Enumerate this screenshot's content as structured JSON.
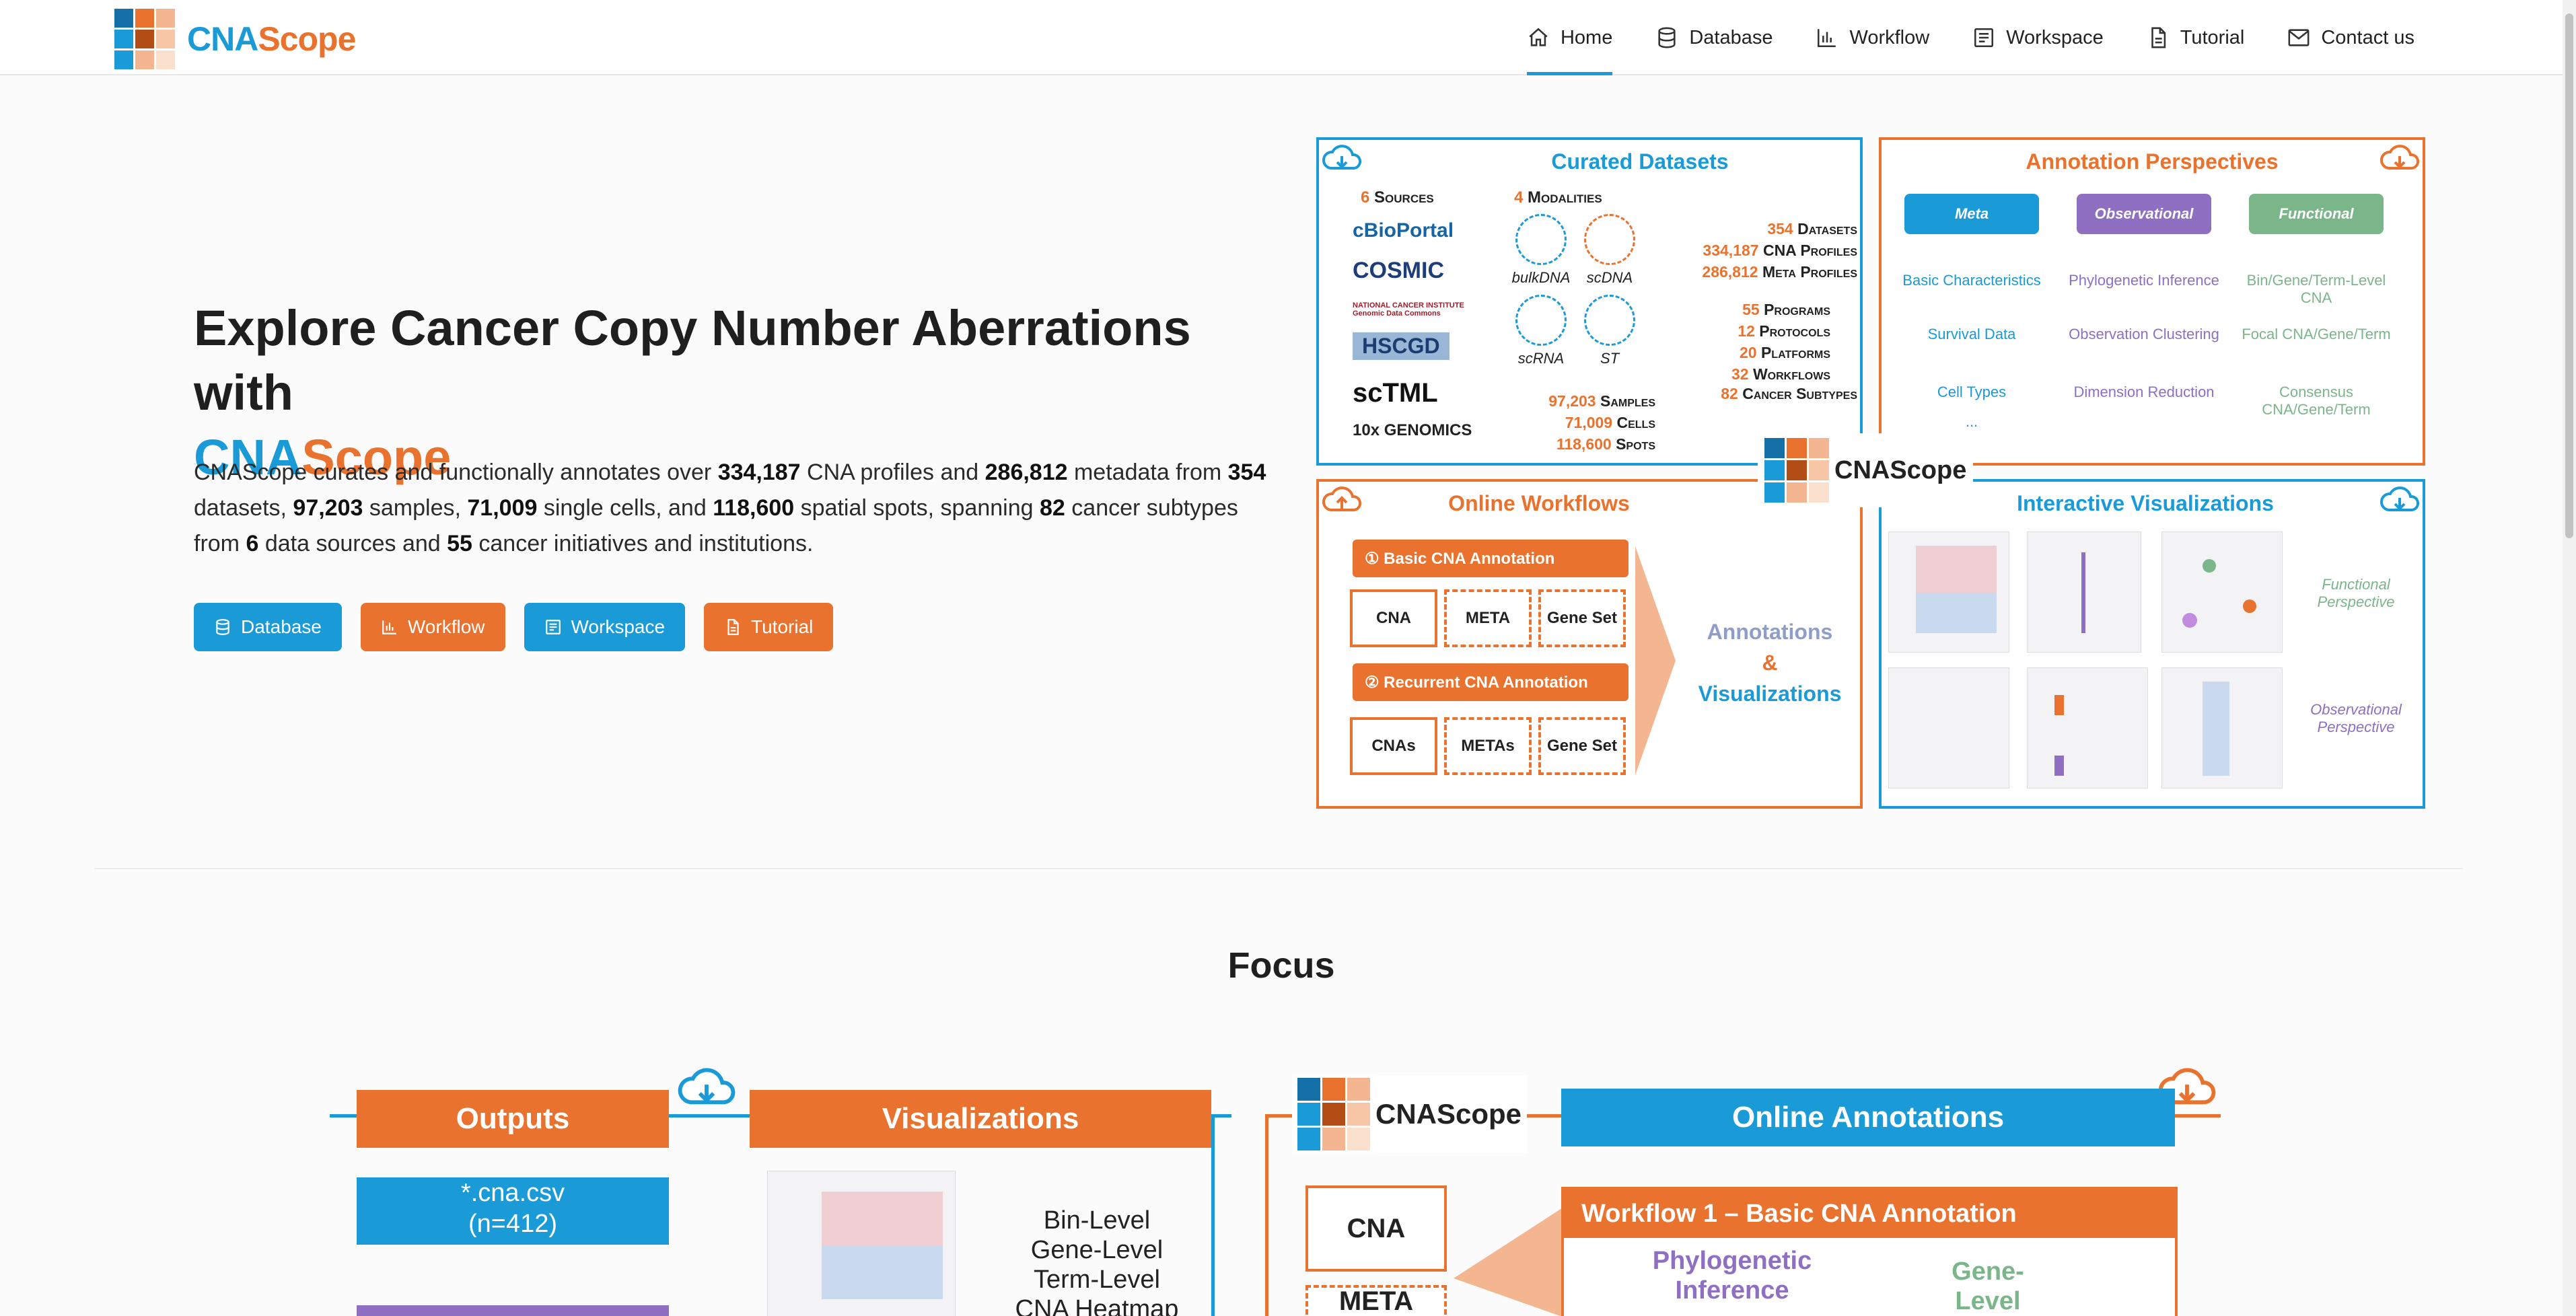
{
  "brand": {
    "name_a": "CNA",
    "name_b": "Scope"
  },
  "nav": [
    {
      "label": "Home",
      "icon": "home-icon"
    },
    {
      "label": "Database",
      "icon": "database-icon"
    },
    {
      "label": "Workflow",
      "icon": "chart-icon"
    },
    {
      "label": "Workspace",
      "icon": "workspace-icon"
    },
    {
      "label": "Tutorial",
      "icon": "document-icon"
    },
    {
      "label": "Contact us",
      "icon": "mail-icon"
    }
  ],
  "hero": {
    "title_line1": "Explore Cancer Copy Number Aberrations with",
    "title_a": "CNA",
    "title_b": "Scope",
    "desc": {
      "p1": "CNAScope curates and functionally annotates over ",
      "n1": "334,187",
      "p2": " CNA profiles and ",
      "n2": "286,812",
      "p3": " metadata from ",
      "n3": "354",
      "p4": " datasets, ",
      "n4": "97,203",
      "p5": " samples, ",
      "n5": "71,009",
      "p6": " single cells, and ",
      "n6": "118,600",
      "p7": " spatial spots, spanning ",
      "n7": "82",
      "p8": " cancer subtypes from ",
      "n8": "6",
      "p9": " data sources and ",
      "n9": "55",
      "p10": " cancer initiatives and institutions."
    },
    "buttons": [
      {
        "label": "Database",
        "color": "#1a9bd7"
      },
      {
        "label": "Workflow",
        "color": "#e9722e"
      },
      {
        "label": "Workspace",
        "color": "#1a9bd7"
      },
      {
        "label": "Tutorial",
        "color": "#e9722e"
      }
    ]
  },
  "figure": {
    "curated": {
      "title": "Curated Datasets",
      "sources_n": "6",
      "sources_label": "Sources",
      "modalities_n": "4",
      "modalities_label": "Modalities",
      "sources": [
        "cBioPortal",
        "COSMIC",
        "NATIONAL CANCER INSTITUTE Genomic Data Commons",
        "HSCGD",
        "scTML",
        "10x GENOMICS"
      ],
      "modalities": [
        "bulkDNA",
        "scDNA",
        "scRNA",
        "ST"
      ],
      "stats": [
        {
          "n": "354",
          "label": "Datasets"
        },
        {
          "n": "334,187",
          "label": "CNA Profiles"
        },
        {
          "n": "286,812",
          "label": "Meta Profiles"
        },
        {
          "n": "55",
          "label": "Programs"
        },
        {
          "n": "12",
          "label": "Protocols"
        },
        {
          "n": "20",
          "label": "Platforms"
        },
        {
          "n": "32",
          "label": "Workflows"
        },
        {
          "n": "82",
          "label": "Cancer Subtypes"
        },
        {
          "n": "97,203",
          "label": "Samples"
        },
        {
          "n": "71,009",
          "label": "Cells"
        },
        {
          "n": "118,600",
          "label": "Spots"
        }
      ]
    },
    "annotation": {
      "title": "Annotation Perspectives",
      "chips": [
        "Meta",
        "Observational",
        "Functional"
      ],
      "meta": [
        "Basic Characteristics",
        "Survival Data",
        "Cell Types",
        "..."
      ],
      "observational": [
        "Phylogenetic Inference",
        "Observation Clustering",
        "Dimension Reduction"
      ],
      "functional": [
        "Bin/Gene/Term-Level CNA",
        "Focal CNA/Gene/Term",
        "Consensus CNA/Gene/Term"
      ]
    },
    "center_logo": "CNAScope",
    "workflows": {
      "title": "Online Workflows",
      "w1": "① Basic CNA Annotation",
      "w1_docs": [
        "CNA",
        "META",
        "Gene Set"
      ],
      "w2": "② Recurrent CNA Annotation",
      "w2_docs": [
        "CNAs",
        "METAs",
        "Gene Set"
      ],
      "result_a": "Annotations",
      "result_amp": "&",
      "result_b": "Visualizations"
    },
    "visualizations": {
      "title": "Interactive Visualizations",
      "functional": "Functional Perspective",
      "observational": "Observational Perspective"
    }
  },
  "focus": {
    "title": "Focus",
    "outputs": "Outputs",
    "visualizations": "Visualizations",
    "online_annotations": "Online Annotations",
    "cna_file": "*.cna.csv",
    "cna_count": "(n=412)",
    "bin_level": "Bin-Level",
    "gene_level": "Gene-Level",
    "term_level": "Term-Level",
    "heatmap": "CNA Heatmap",
    "cna_doc": "CNA",
    "meta_doc": "META",
    "workflow1": "Workflow 1 – Basic CNA Annotation",
    "phylo": "Phylogenetic Inference",
    "gene_cna": "Gene-Level CNA",
    "logo": "CNAScope"
  },
  "colors": {
    "blue": "#1a9bd7",
    "orange": "#e9722e",
    "purple": "#8e6fc1",
    "green": "#7bb58a"
  }
}
